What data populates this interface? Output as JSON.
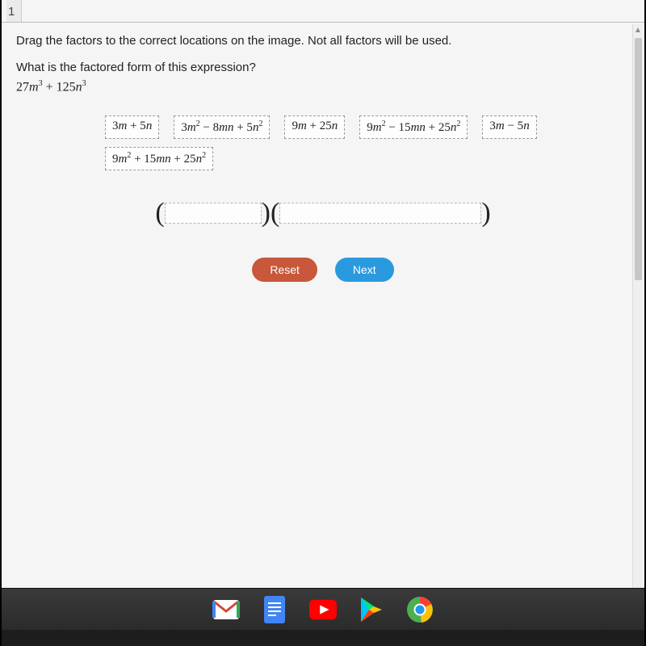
{
  "topbar": {
    "label": "1"
  },
  "instruction": "Drag the factors to the correct locations on the image. Not all factors will be used.",
  "question": "What is the factored form of this expression?",
  "expression_plain": "27m³ + 125n³",
  "factors": {
    "f1": "3m + 5n",
    "f2": "3m² − 8mn + 5n²",
    "f3": "9m + 25n",
    "f4": "9m² − 15mn + 25n²",
    "f5": "3m − 5n",
    "f6": "9m² + 15mn + 25n²"
  },
  "buttons": {
    "reset": "Reset",
    "next": "Next"
  },
  "icons": {
    "gmail": "gmail-icon",
    "docs": "docs-icon",
    "youtube": "youtube-icon",
    "play": "play-icon",
    "chrome": "chrome-icon"
  }
}
